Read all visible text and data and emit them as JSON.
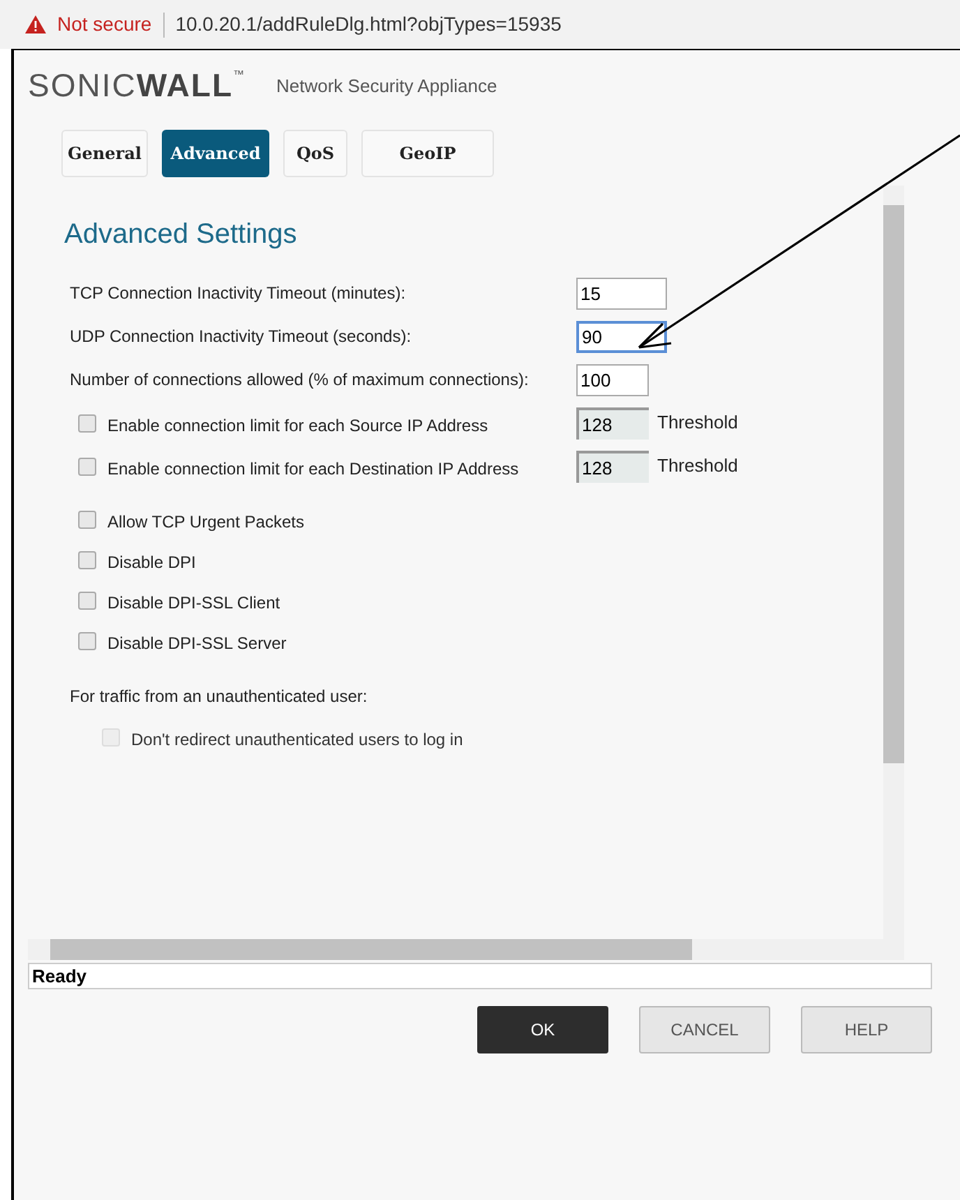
{
  "address_bar": {
    "security": "Not secure",
    "url": "10.0.20.1/addRuleDlg.html?objTypes=15935"
  },
  "header": {
    "logo_left": "SONIC",
    "logo_right": "WALL",
    "logo_mark": "™",
    "subtitle": "Network Security Appliance"
  },
  "tabs": [
    {
      "label": "General",
      "selected": false
    },
    {
      "label": "Advanced",
      "selected": true
    },
    {
      "label": "QoS",
      "selected": false
    },
    {
      "label": "GeoIP",
      "selected": false
    }
  ],
  "section_title": "Advanced Settings",
  "fields": [
    {
      "label": "TCP Connection Inactivity Timeout (minutes):",
      "value": "15",
      "focused": false
    },
    {
      "label": "UDP Connection Inactivity Timeout (seconds):",
      "value": "90",
      "focused": true
    },
    {
      "label": "Number of connections allowed (% of maximum connections):",
      "value": "100",
      "focused": false
    }
  ],
  "limits": [
    {
      "label": "Enable connection limit for each Source IP Address",
      "checked": false,
      "value": "128",
      "suffix": "Threshold"
    },
    {
      "label": "Enable connection limit for each Destination IP Address",
      "checked": false,
      "value": "128",
      "suffix": "Threshold"
    }
  ],
  "options": [
    {
      "label": "Allow TCP Urgent Packets",
      "checked": false
    },
    {
      "label": "Disable DPI",
      "checked": false
    },
    {
      "label": "Disable DPI-SSL Client",
      "checked": false
    },
    {
      "label": "Disable DPI-SSL Server",
      "checked": false
    }
  ],
  "unauth": {
    "label": "For traffic from an unauthenticated user:",
    "option": {
      "label": "Don't redirect unauthenticated users to log in",
      "checked": false,
      "disabled": true
    }
  },
  "status_bar": "Ready",
  "buttons": [
    {
      "label": "OK",
      "kind": "primary"
    },
    {
      "label": "CANCEL",
      "kind": "secondary"
    },
    {
      "label": "HELP",
      "kind": "secondary"
    }
  ]
}
